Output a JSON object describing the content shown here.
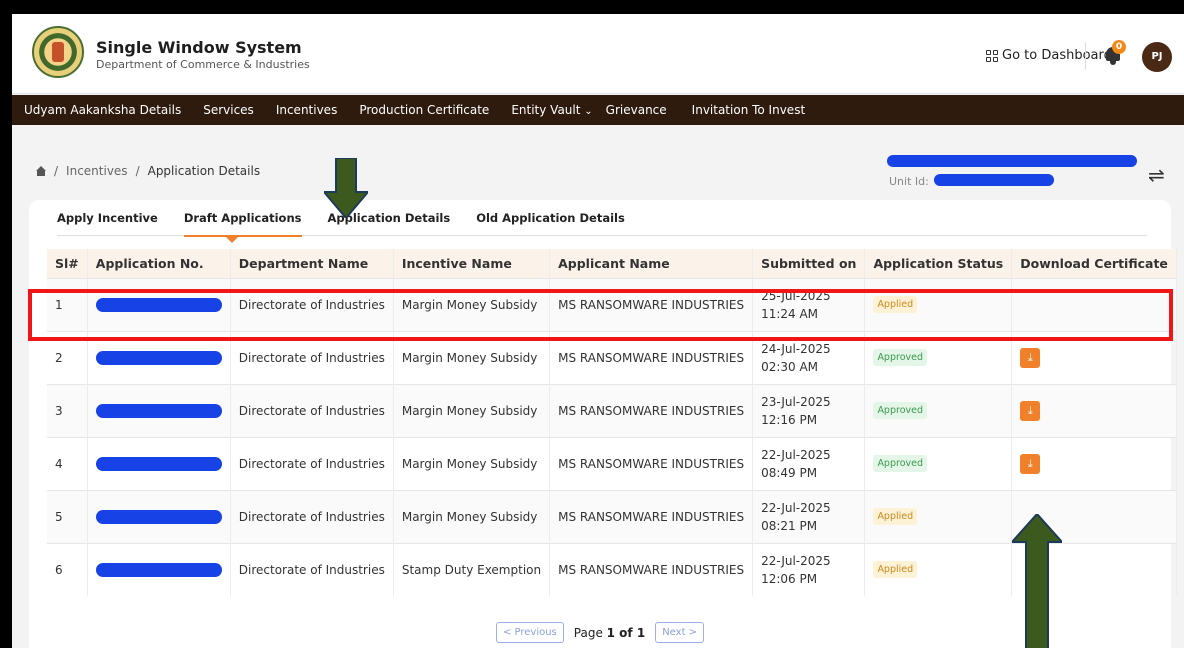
{
  "header": {
    "title": "Single Window System",
    "subtitle": "Department of Commerce & Industries",
    "dashboard_link": "Go to Dashboard",
    "notification_count": "0",
    "avatar_initials": "PJ"
  },
  "nav": {
    "items": [
      "Udyam Aakanksha Details",
      "Services",
      "Incentives",
      "Production Certificate",
      "Entity Vault",
      "Grievance",
      "Invitation To Invest"
    ]
  },
  "breadcrumb": {
    "items": [
      "Incentives",
      "Application Details"
    ]
  },
  "unit": {
    "label": "Unit Id:"
  },
  "tabs": [
    "Apply Incentive",
    "Draft Applications",
    "Application Details",
    "Old Application Details"
  ],
  "active_tab": "Draft Applications",
  "table": {
    "columns": [
      "Sl#",
      "Application No.",
      "Department Name",
      "Incentive Name",
      "Applicant Name",
      "Submitted on",
      "Application Status",
      "Download Certificate"
    ],
    "rows": [
      {
        "sl": "1",
        "department": "Directorate of Industries",
        "incentive": "Margin Money Subsidy",
        "applicant": "MS RANSOMWARE INDUSTRIES",
        "date": "25-Jul-2025",
        "time": "11:24 AM",
        "status": "Applied",
        "download": false
      },
      {
        "sl": "2",
        "department": "Directorate of Industries",
        "incentive": "Margin Money Subsidy",
        "applicant": "MS RANSOMWARE INDUSTRIES",
        "date": "24-Jul-2025",
        "time": "02:30 AM",
        "status": "Approved",
        "download": true
      },
      {
        "sl": "3",
        "department": "Directorate of Industries",
        "incentive": "Margin Money Subsidy",
        "applicant": "MS RANSOMWARE INDUSTRIES",
        "date": "23-Jul-2025",
        "time": "12:16 PM",
        "status": "Approved",
        "download": true
      },
      {
        "sl": "4",
        "department": "Directorate of Industries",
        "incentive": "Margin Money Subsidy",
        "applicant": "MS RANSOMWARE INDUSTRIES",
        "date": "22-Jul-2025",
        "time": "08:49 PM",
        "status": "Approved",
        "download": true
      },
      {
        "sl": "5",
        "department": "Directorate of Industries",
        "incentive": "Margin Money Subsidy",
        "applicant": "MS RANSOMWARE INDUSTRIES",
        "date": "22-Jul-2025",
        "time": "08:21 PM",
        "status": "Applied",
        "download": false
      },
      {
        "sl": "6",
        "department": "Directorate of Industries",
        "incentive": "Stamp Duty Exemption",
        "applicant": "MS RANSOMWARE INDUSTRIES",
        "date": "22-Jul-2025",
        "time": "12:06 PM",
        "status": "Applied",
        "download": false
      }
    ]
  },
  "pagination": {
    "previous": "< Previous",
    "label_prefix": "Page ",
    "label_value": "1 of 1",
    "next": "Next >"
  },
  "colors": {
    "accent": "#f0802a",
    "nav_bg": "#2e1b0e",
    "highlight": "#ee1616",
    "annotation_arrow": "#3d5a1e",
    "redaction": "#1642e6"
  }
}
